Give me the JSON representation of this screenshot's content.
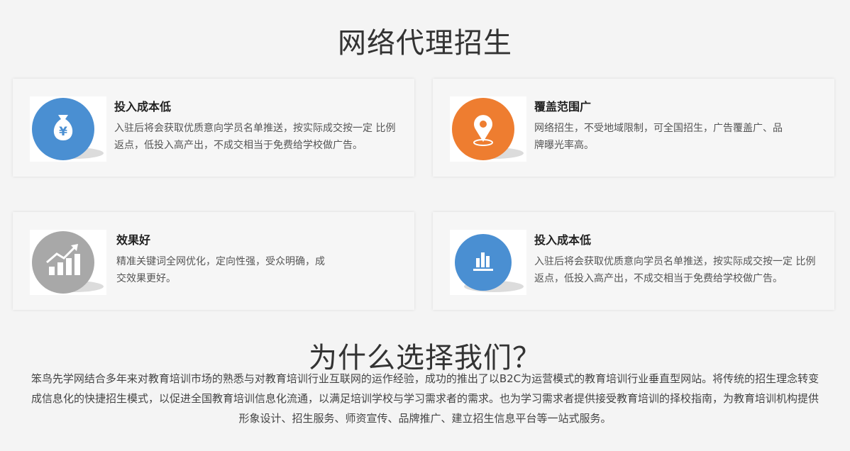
{
  "section1": {
    "title": "网络代理招生"
  },
  "cards": [
    {
      "icon": "money-bag-icon",
      "icon_color": "#4a8fd2",
      "title": "投入成本低",
      "desc": "入驻后将会获取优质意向学员名单推送，按实际成交按一定 比例返点，低投入高产出，不成交相当于免费给学校做广告。"
    },
    {
      "icon": "location-pin-icon",
      "icon_color": "#ee7d30",
      "title": "覆盖范围广",
      "desc": "网络招生，不受地域限制，可全国招生，广告覆盖广、品牌曝光率高。"
    },
    {
      "icon": "growth-chart-icon",
      "icon_color": "#a8a8a8",
      "title": "效果好",
      "desc": "精准关键词全网优化，定向性强，受众明确，成交效果更好。"
    },
    {
      "icon": "bar-chart-icon",
      "icon_color": "#4a8fd2",
      "title": "投入成本低",
      "desc": "入驻后将会获取优质意向学员名单推送，按实际成交按一定 比例返点，低投入高产出，不成交相当于免费给学校做广告。"
    }
  ],
  "section2": {
    "title": "为什么选择我们？",
    "desc": "笨鸟先学网结合多年来对教育培训市场的熟悉与对教育培训行业互联网的运作经验，成功的推出了以B2C为运营模式的教育培训行业垂直型网站。将传统的招生理念转变成信息化的快捷招生模式，以促进全国教育培训信息化流通，以满足培训学校与学习需求者的需求。也为学习需求者提供接受教育培训的择校指南，为教育培训机构提供形象设计、招生服务、师资宣传、品牌推广、建立招生信息平台等一站式服务。"
  }
}
